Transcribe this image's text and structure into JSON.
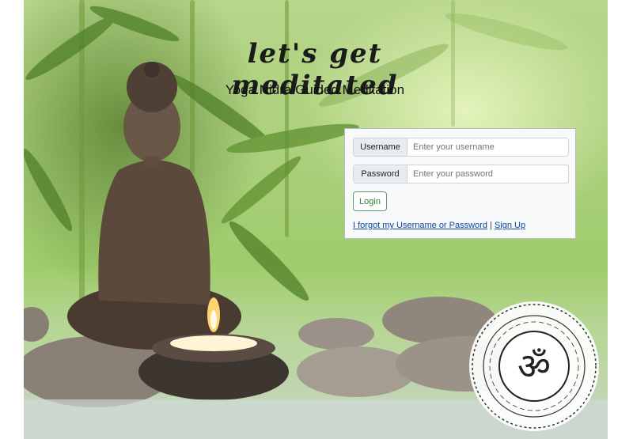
{
  "brand": "let's get meditated",
  "subtitle": "Yoga Nidra Guided Meditation",
  "form": {
    "username_label": "Username",
    "username_placeholder": "Enter your username",
    "password_label": "Password",
    "password_placeholder": "Enter your password",
    "login_label": "Login",
    "forgot_link": "I forgot my Username or Password",
    "separator": "|",
    "signup_link": "Sign Up"
  },
  "colors": {
    "login_accent": "#2e7d3e",
    "link": "#0d47a1",
    "panel_bg": "#f8f9fa"
  },
  "icons": [
    "om-mandala-icon",
    "buddha-statue-image",
    "candle-image"
  ]
}
